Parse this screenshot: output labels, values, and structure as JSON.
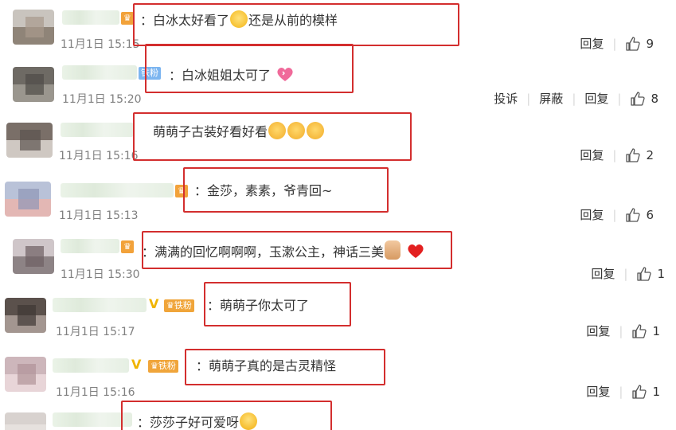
{
  "icons": {
    "like": "thumbs-up-icon",
    "crown_badge": "crown-badge-icon",
    "fan_badge": "fan-badge-icon",
    "verified": "verified-v-icon"
  },
  "colors": {
    "highlight_box": "#d32e2e",
    "time_text": "#808080",
    "action_text": "#333333"
  },
  "comments": [
    {
      "text": "：白冰太好看了",
      "text_after": "还是从前的模样",
      "time": "11月1日 15:15",
      "reply": "回复",
      "likes": "9",
      "emoji": "cry"
    },
    {
      "badge": "铁粉",
      "text": "：白冰姐姐太可了",
      "time": "11月1日 15:20",
      "report": "投诉",
      "block": "屏蔽",
      "reply": "回复",
      "likes": "8",
      "emoji": "heart-pink"
    },
    {
      "text": "萌萌子古装好看好看",
      "time": "11月1日 15:16",
      "reply": "回复",
      "likes": "2",
      "emoji": "shy"
    },
    {
      "text": "：金莎，素素，爷青回~",
      "time": "11月1日 15:13",
      "reply": "回复",
      "likes": "6"
    },
    {
      "text": "：满满的回忆啊啊啊，玉漱公主，神话三美",
      "time": "11月1日 15:30",
      "reply": "回复",
      "likes": "1",
      "emoji": "heart-red"
    },
    {
      "badge": "铁粉",
      "text": "：萌萌子你太可了",
      "time": "11月1日 15:17",
      "reply": "回复",
      "likes": "1"
    },
    {
      "badge": "铁粉",
      "text": "：萌萌子真的是古灵精怪",
      "time": "11月1日 15:16",
      "reply": "回复",
      "likes": "1"
    },
    {
      "text": "：莎莎子好可爱呀",
      "emoji": "laugh"
    }
  ]
}
